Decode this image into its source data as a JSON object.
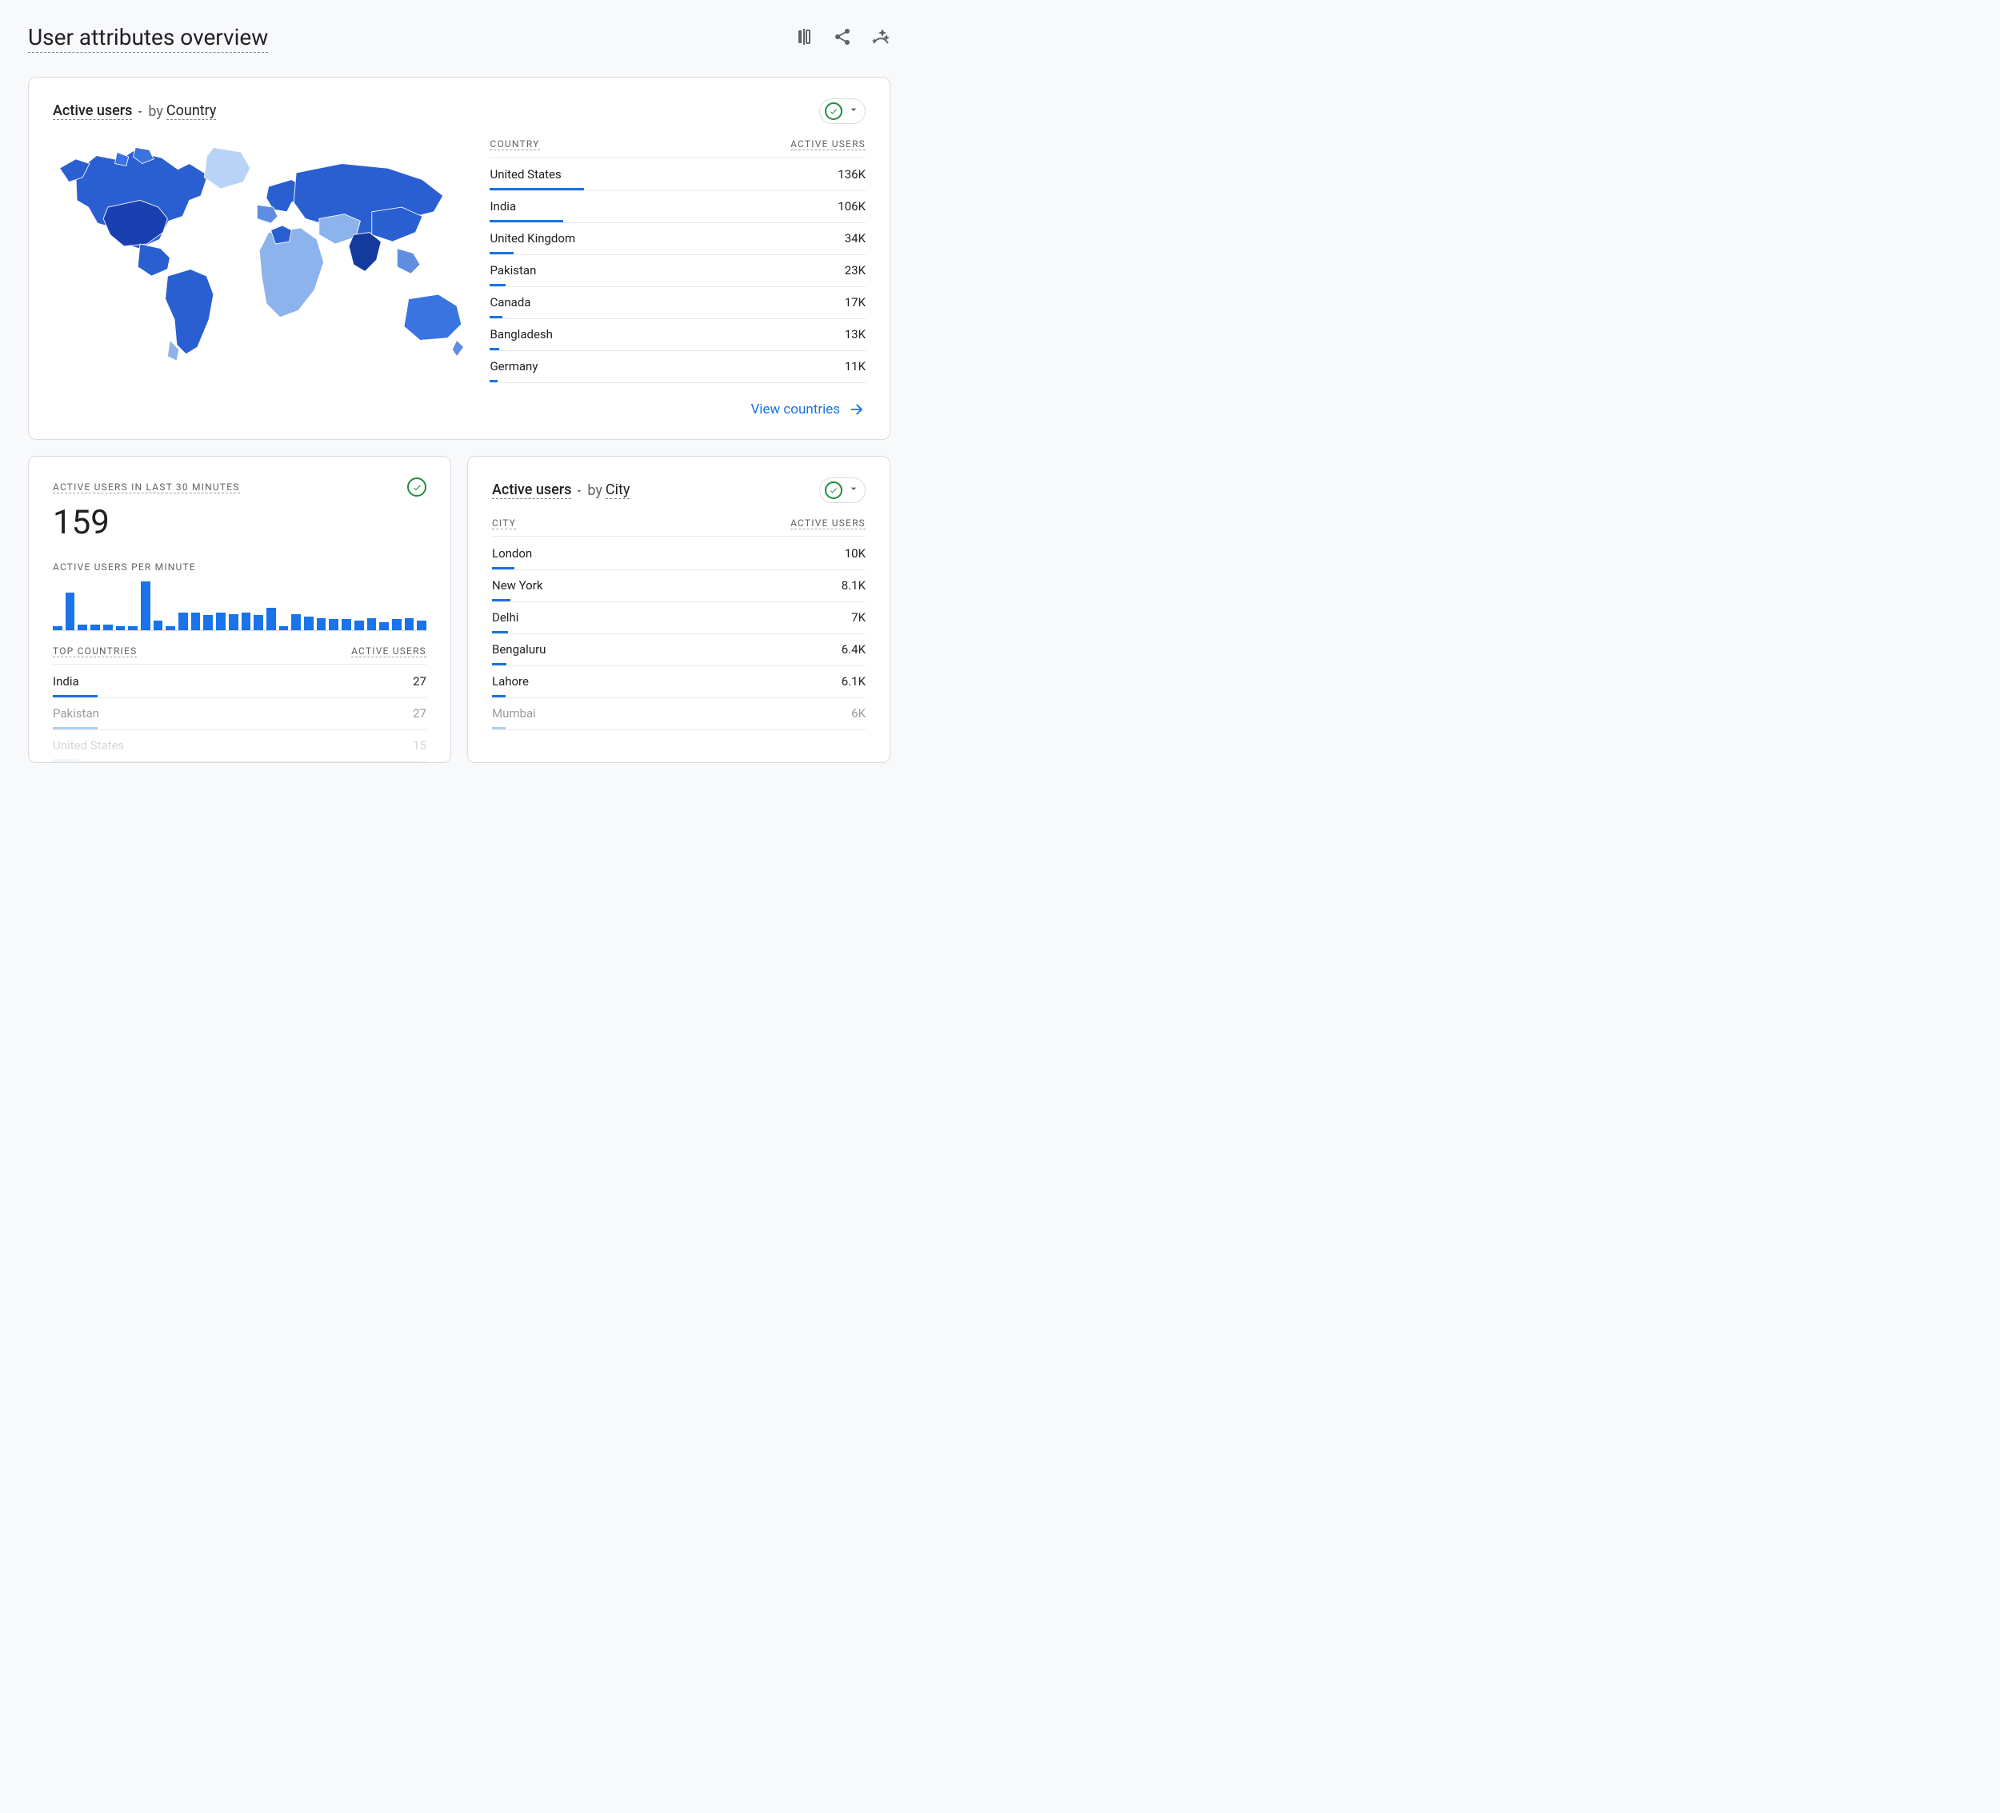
{
  "header": {
    "title": "User attributes overview"
  },
  "country_card": {
    "metric": "Active users",
    "by_label": "by",
    "dimension": "Country",
    "columns": {
      "left": "COUNTRY",
      "right": "ACTIVE USERS"
    },
    "rows": [
      {
        "label": "United States",
        "value": "136K",
        "bar": 100
      },
      {
        "label": "India",
        "value": "106K",
        "bar": 78
      },
      {
        "label": "United Kingdom",
        "value": "34K",
        "bar": 25
      },
      {
        "label": "Pakistan",
        "value": "23K",
        "bar": 17
      },
      {
        "label": "Canada",
        "value": "17K",
        "bar": 13
      },
      {
        "label": "Bangladesh",
        "value": "13K",
        "bar": 10
      },
      {
        "label": "Germany",
        "value": "11K",
        "bar": 8
      }
    ],
    "view_link": "View countries"
  },
  "realtime_card": {
    "title": "ACTIVE USERS IN LAST 30 MINUTES",
    "value": "159",
    "per_minute_label": "ACTIVE USERS PER MINUTE",
    "top_countries_label": "TOP COUNTRIES",
    "active_users_label": "ACTIVE USERS",
    "top_rows": [
      {
        "label": "India",
        "value": "27",
        "bar": 100,
        "fade": ""
      },
      {
        "label": "Pakistan",
        "value": "27",
        "bar": 100,
        "fade": "fade-row"
      },
      {
        "label": "United States",
        "value": "15",
        "bar": 56,
        "fade": "fade-row2"
      }
    ]
  },
  "city_card": {
    "metric": "Active users",
    "by_label": "by",
    "dimension": "City",
    "columns": {
      "left": "CITY",
      "right": "ACTIVE USERS"
    },
    "rows": [
      {
        "label": "London",
        "value": "10K",
        "bar": 100
      },
      {
        "label": "New York",
        "value": "8.1K",
        "bar": 81
      },
      {
        "label": "Delhi",
        "value": "7K",
        "bar": 70
      },
      {
        "label": "Bengaluru",
        "value": "6.4K",
        "bar": 64
      },
      {
        "label": "Lahore",
        "value": "6.1K",
        "bar": 61
      },
      {
        "label": "Mumbai",
        "value": "6K",
        "bar": 60,
        "fade": "fade-row"
      }
    ]
  },
  "chart_data": {
    "type": "bar",
    "title": "Active users per minute",
    "categories_note": "last 30 minutes (no axis labels shown)",
    "values": [
      8,
      70,
      10,
      10,
      10,
      8,
      8,
      90,
      18,
      8,
      32,
      32,
      28,
      32,
      30,
      32,
      28,
      42,
      8,
      30,
      25,
      22,
      20,
      20,
      18,
      22,
      15,
      20,
      22,
      18
    ],
    "xlabel": "",
    "ylabel": ""
  }
}
